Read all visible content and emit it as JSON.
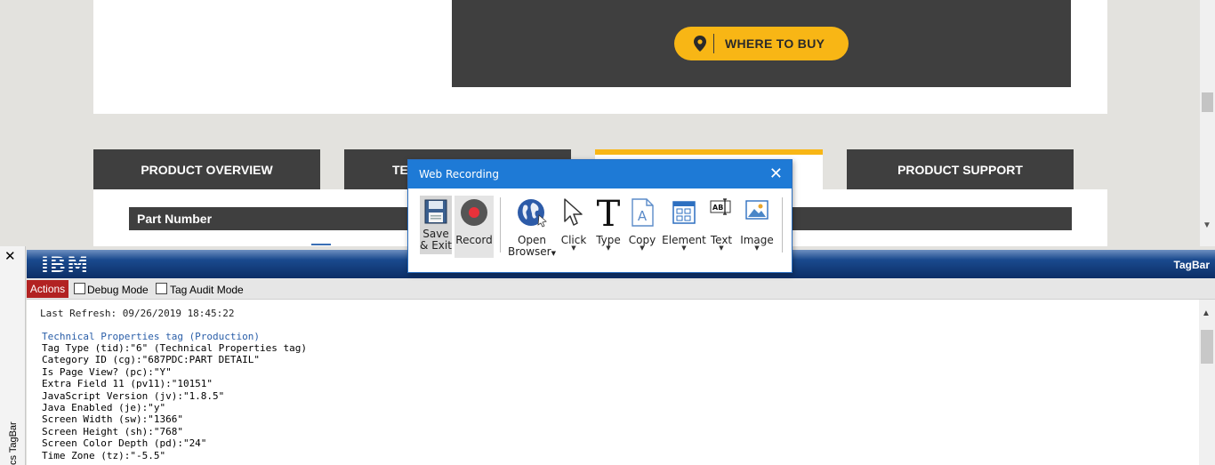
{
  "webpage": {
    "where_to_buy_label": "WHERE TO BUY",
    "tabs": [
      {
        "label": "PRODUCT OVERVIEW"
      },
      {
        "label": "TE"
      },
      {
        "label": ""
      },
      {
        "label": "PRODUCT SUPPORT"
      }
    ],
    "part_number_header": "Part Number",
    "accent_color": "#f8b615"
  },
  "dialog": {
    "title": "Web Recording",
    "close_glyph": "✕",
    "tools": {
      "save": {
        "line1": "Save",
        "line2": "& Exit"
      },
      "record": {
        "label": "Record"
      },
      "open_browser": {
        "line1": "Open",
        "line2": "Browser"
      },
      "click": {
        "label": "Click"
      },
      "type": {
        "label": "Type"
      },
      "copy": {
        "label": "Copy"
      },
      "element": {
        "label": "Element"
      },
      "text": {
        "label": "Text"
      },
      "image": {
        "label": "Image"
      }
    },
    "dropdown_glyph": "▼"
  },
  "tagbar": {
    "close_glyph": "✕",
    "logo_text": "IBM",
    "title": "TagBar",
    "side_label": "cs TagBar",
    "actions_label": "Actions",
    "debug_mode_label": "Debug Mode",
    "tag_audit_mode_label": "Tag Audit Mode",
    "debug_mode_checked": false,
    "tag_audit_mode_checked": false,
    "last_refresh": "Last Refresh: 09/26/2019 18:45:22",
    "tag_title": "Technical Properties tag (Production)",
    "tag_lines": [
      "Tag Type (tid):\"6\" (Technical Properties tag)",
      "Category ID (cg):\"687PDC:PART DETAIL\"",
      "Is Page View? (pc):\"Y\"",
      "Extra Field 11 (pv11):\"10151\"",
      "JavaScript Version (jv):\"1.8.5\"",
      "Java Enabled (je):\"y\"",
      "Screen Width (sw):\"1366\"",
      "Screen Height (sh):\"768\"",
      "Screen Color Depth (pd):\"24\"",
      "Time Zone (tz):\"-5.5\""
    ]
  }
}
